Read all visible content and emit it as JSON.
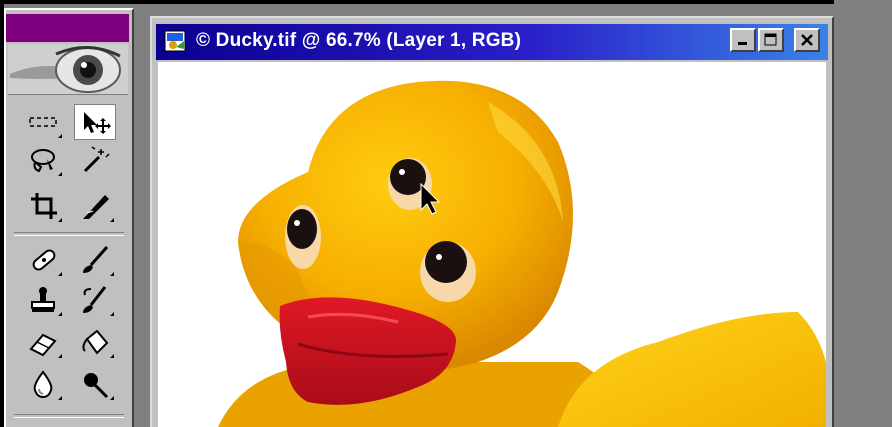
{
  "document": {
    "title": "© Ducky.tif @ 66.7% (Layer 1, RGB)"
  },
  "toolbox": {
    "tools": [
      {
        "name": "marquee-tool-icon"
      },
      {
        "name": "move-tool-icon",
        "selected": true
      },
      {
        "name": "lasso-tool-icon"
      },
      {
        "name": "magic-wand-tool-icon"
      },
      {
        "name": "crop-tool-icon"
      },
      {
        "name": "slice-tool-icon"
      },
      {
        "name": "healing-brush-tool-icon"
      },
      {
        "name": "brush-tool-icon"
      },
      {
        "name": "clone-stamp-tool-icon"
      },
      {
        "name": "history-brush-tool-icon"
      },
      {
        "name": "eraser-tool-icon"
      },
      {
        "name": "paint-bucket-tool-icon"
      },
      {
        "name": "blur-tool-icon"
      },
      {
        "name": "dodge-tool-icon"
      }
    ]
  },
  "colors": {
    "toolbox_title": "#7f007f",
    "titlebar_start": "#0a0090",
    "titlebar_end": "#3a82e8",
    "duck_yellow": "#f7b400",
    "beak_red": "#d0141e"
  }
}
